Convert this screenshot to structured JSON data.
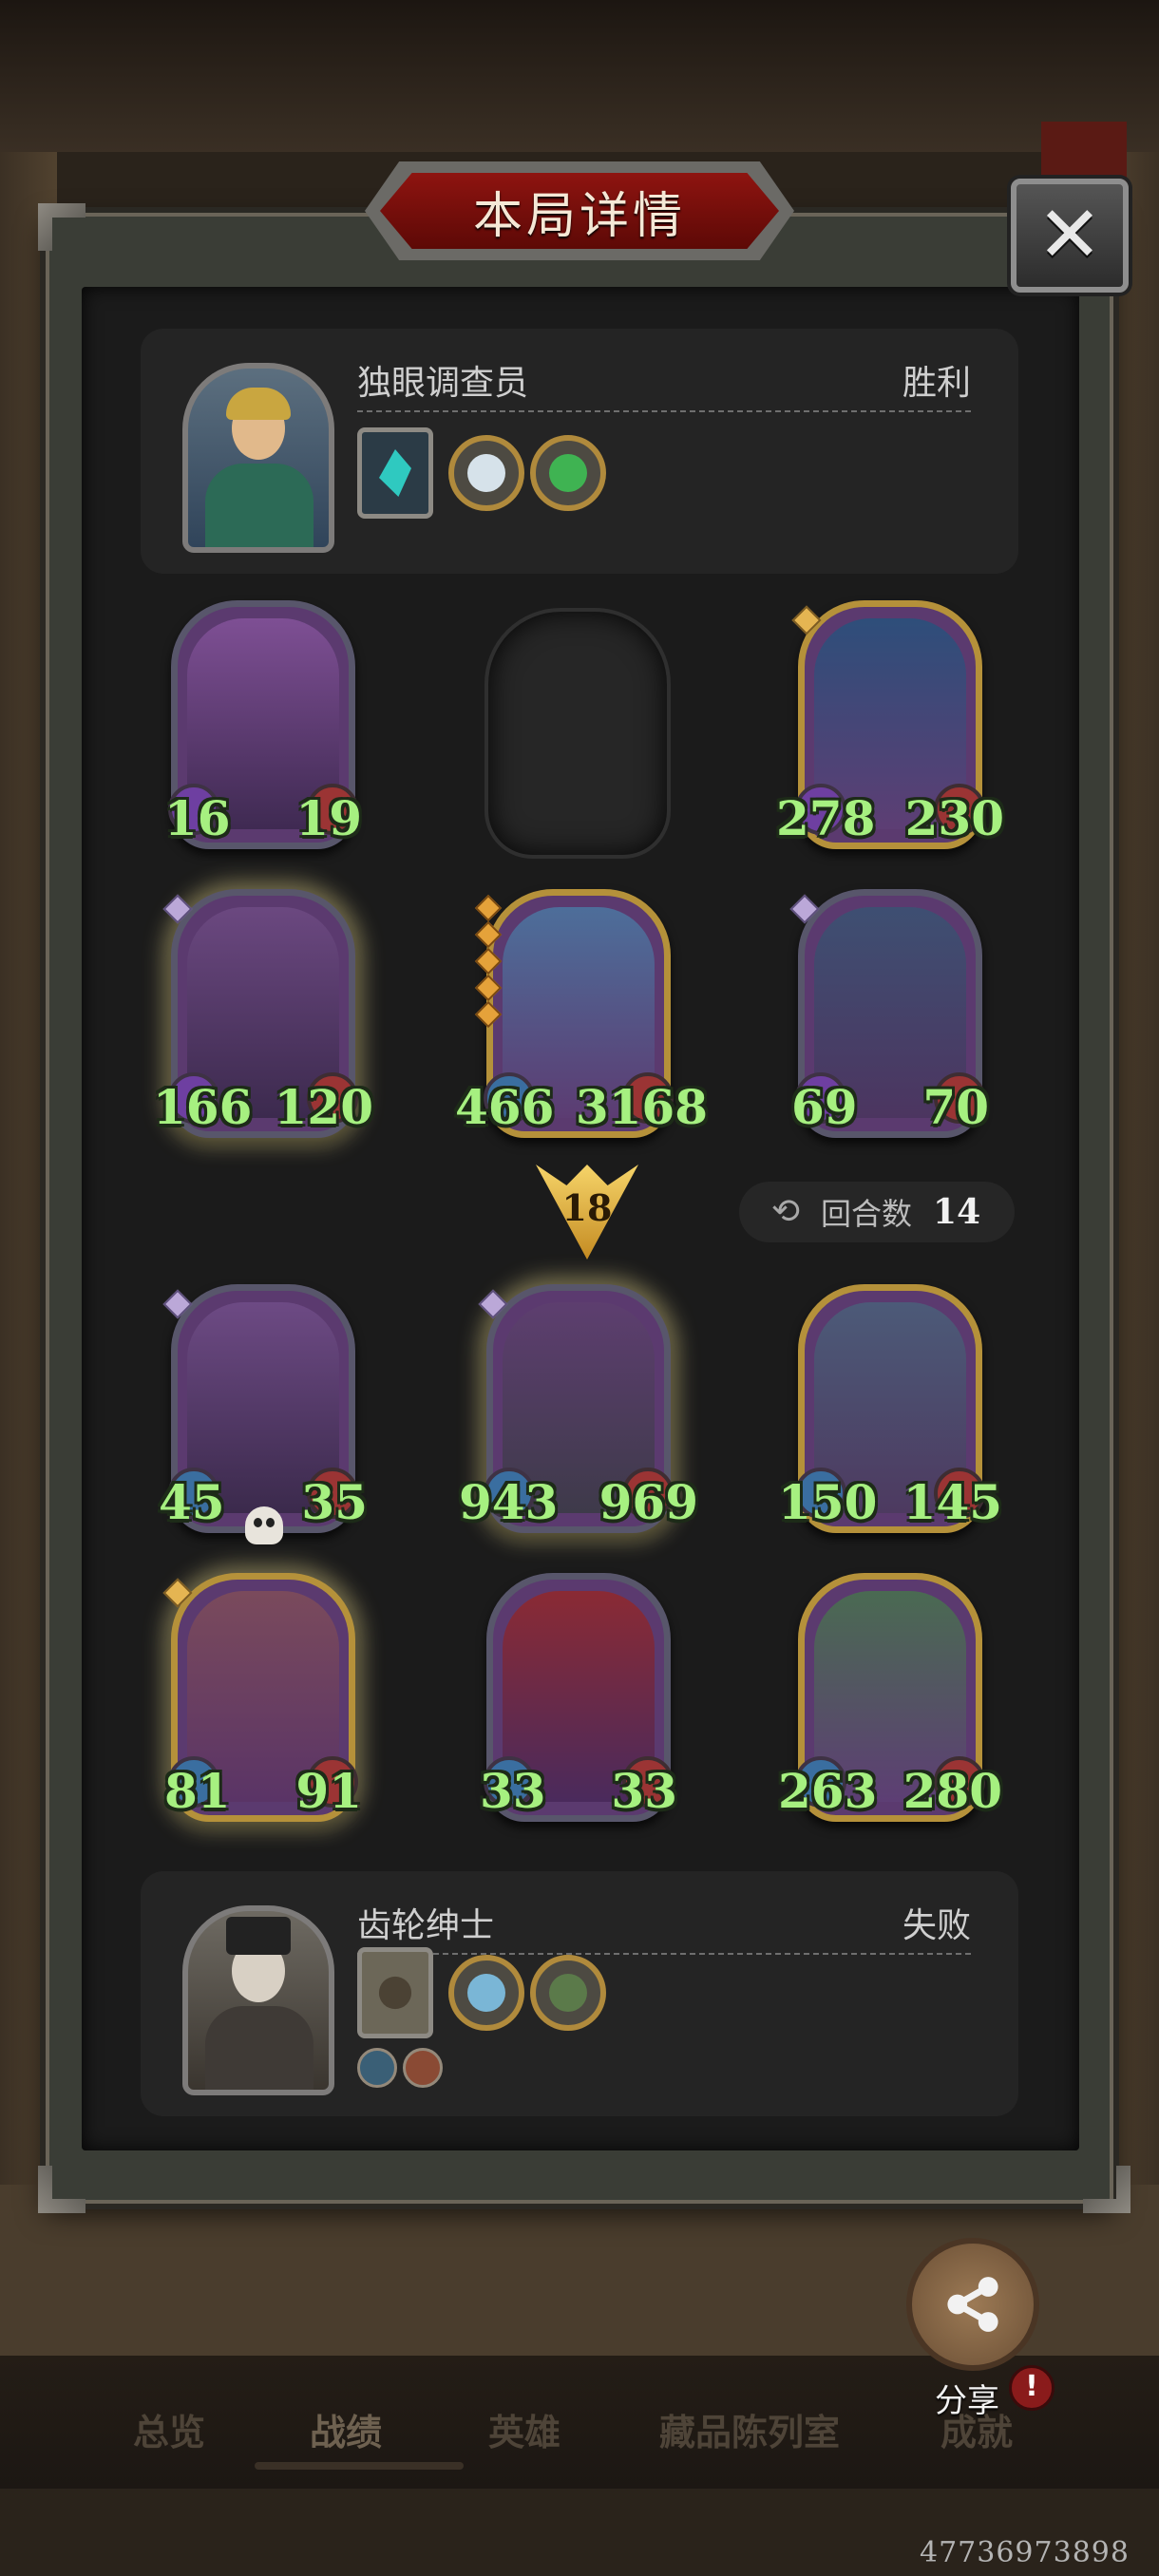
{
  "title": "本局详情",
  "close_icon": "close-icon",
  "player": {
    "name": "独眼调查员",
    "result": "胜利"
  },
  "opponent": {
    "name": "齿轮绅士",
    "result": "失败"
  },
  "round": {
    "label": "回合数",
    "value": "14"
  },
  "damage": "18",
  "player_units": [
    {
      "atk": "16",
      "hp": "19"
    },
    {
      "atk": "278",
      "hp": "230"
    },
    {
      "atk": "166",
      "hp": "120"
    },
    {
      "atk": "466",
      "hp": "3168"
    },
    {
      "atk": "69",
      "hp": "70"
    }
  ],
  "opponent_units": [
    {
      "atk": "45",
      "hp": "35"
    },
    {
      "atk": "943",
      "hp": "969"
    },
    {
      "atk": "150",
      "hp": "145"
    },
    {
      "atk": "81",
      "hp": "91"
    },
    {
      "atk": "33",
      "hp": "33"
    },
    {
      "atk": "263",
      "hp": "280"
    }
  ],
  "share_label": "分享",
  "alert": "!",
  "nav": [
    "总览",
    "战绩",
    "英雄",
    "藏品陈列室",
    "成就"
  ],
  "id_text": "47736973898",
  "colors": {
    "stat": "#a6f080",
    "banner": "#8e1410",
    "gold_frame": "#b5913a"
  }
}
